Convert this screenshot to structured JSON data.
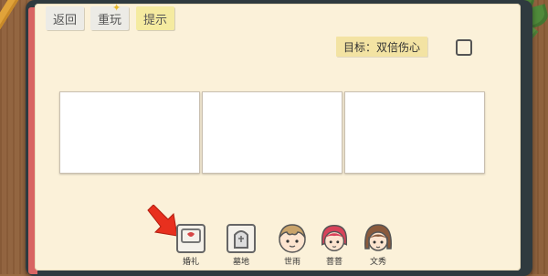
{
  "top_buttons": {
    "back": "返回",
    "replay": "重玩",
    "hint": "提示"
  },
  "goal": {
    "text": "目标：双倍伤心",
    "checked": false
  },
  "panels_count": 3,
  "items": [
    {
      "id": "wedding",
      "label": "婚礼",
      "icon": "wedding-card-icon"
    },
    {
      "id": "tomb",
      "label": "墓地",
      "icon": "tombstone-icon"
    },
    {
      "id": "boy",
      "label": "世雨",
      "icon": "boy-character-icon"
    },
    {
      "id": "girl",
      "label": "菩菩",
      "icon": "red-hair-girl-icon"
    },
    {
      "id": "woman",
      "label": "文秀",
      "icon": "brown-hair-girl-icon"
    }
  ],
  "colors": {
    "paper": "#fbf1d9",
    "hint_button": "#f5eba0",
    "goal_bg": "#f3e3a3",
    "arrow": "#e8301e"
  }
}
